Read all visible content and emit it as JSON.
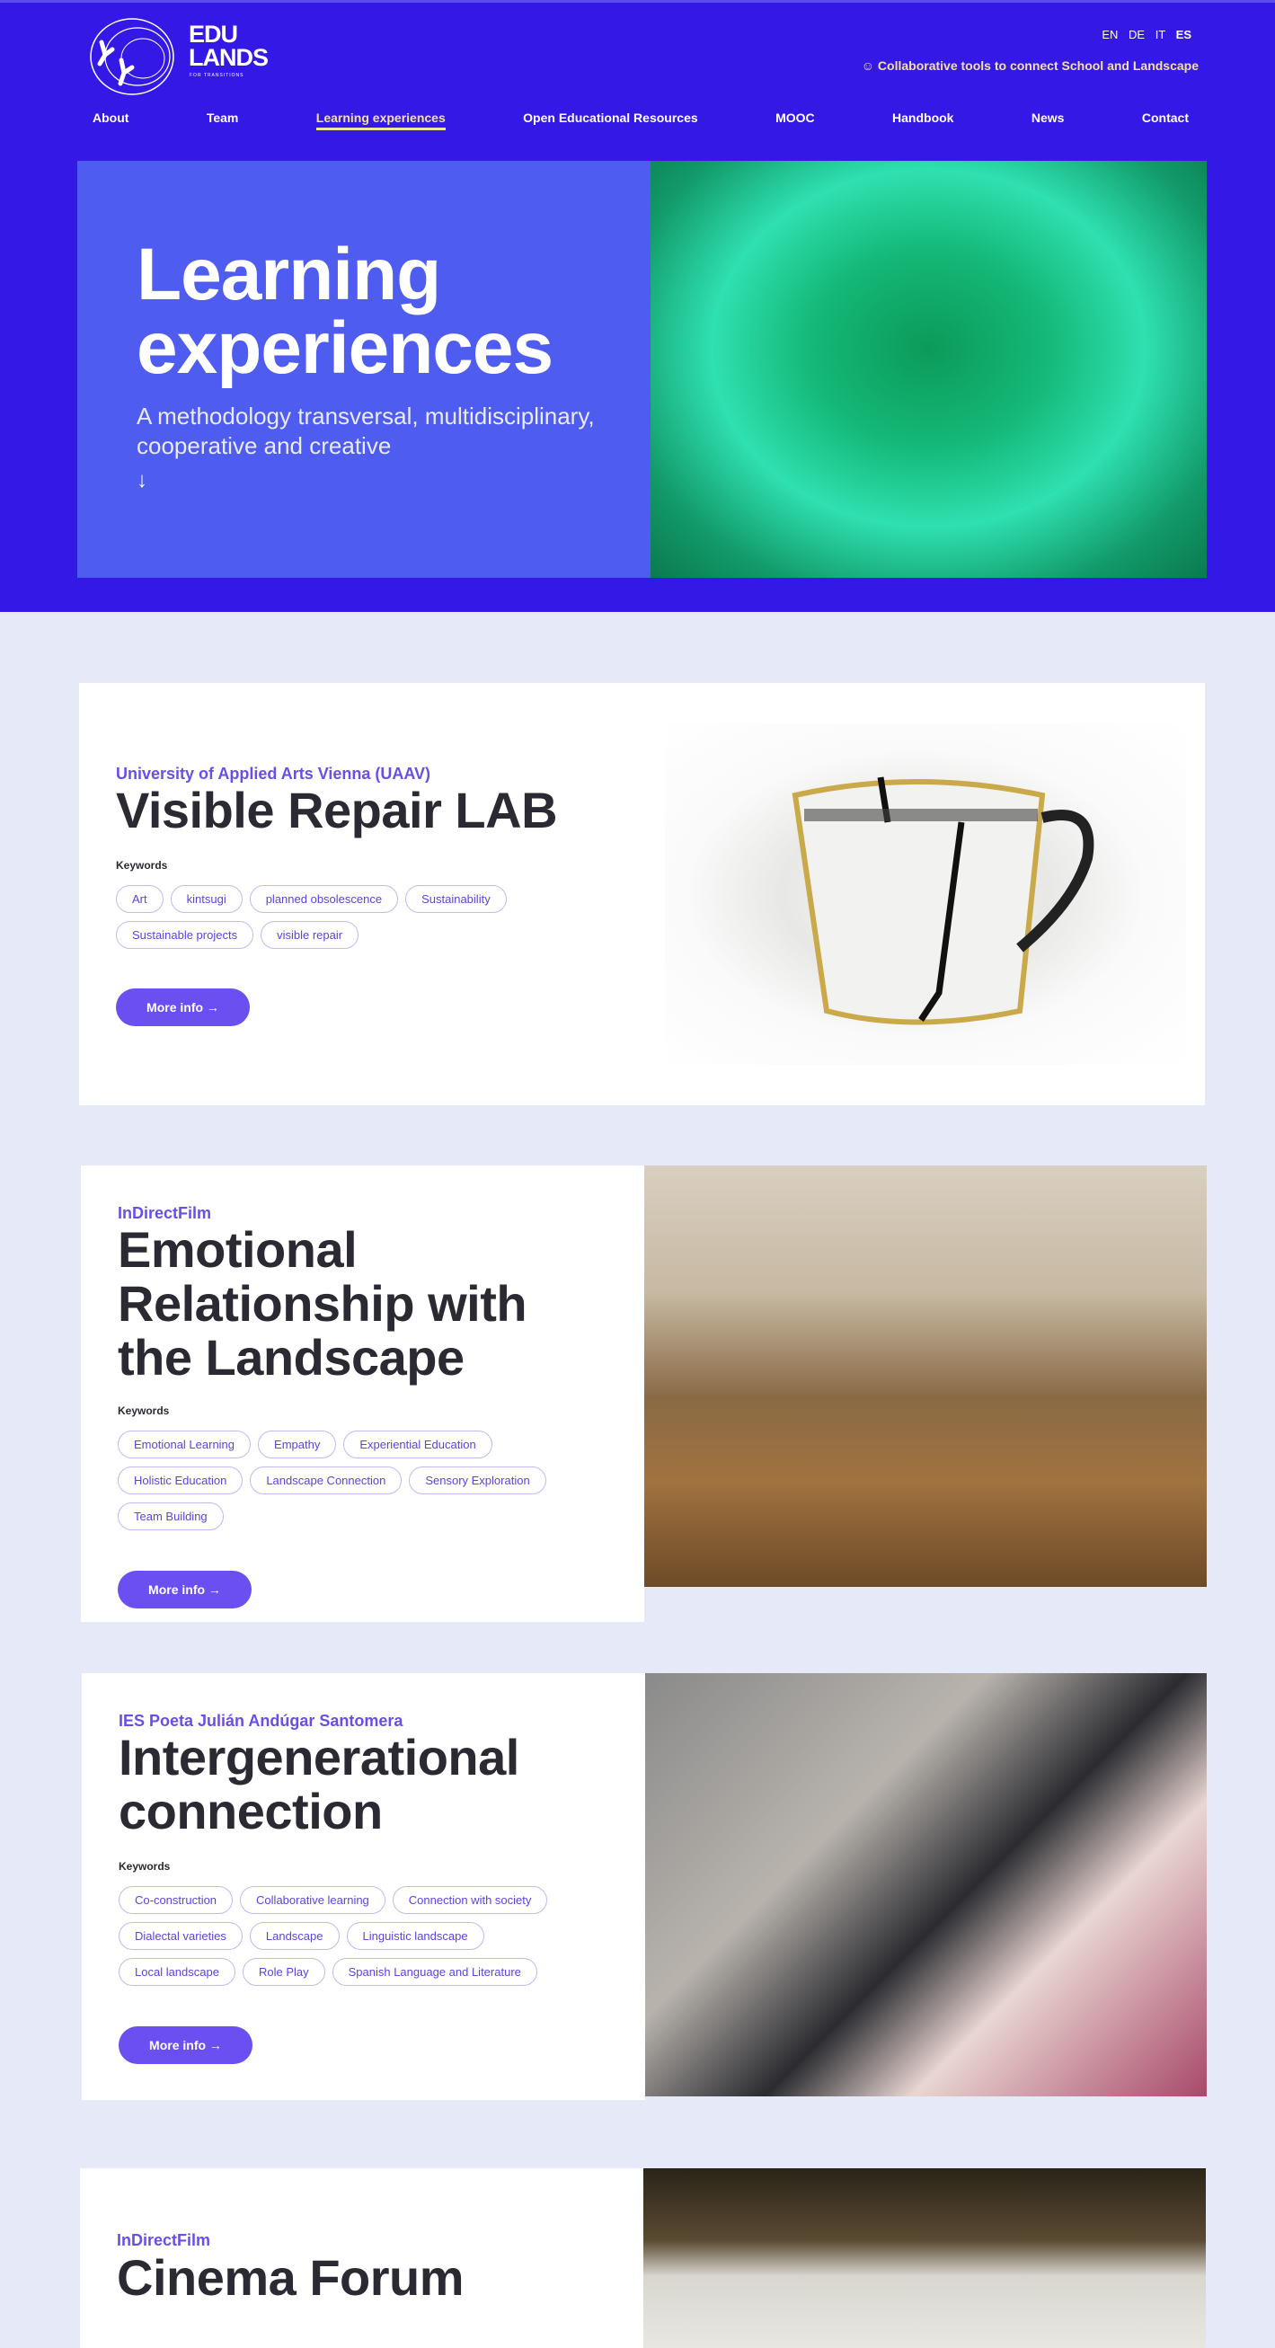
{
  "header": {
    "logo_text": "EDU LANDS",
    "logo_sub": "FOR TRANSITIONS",
    "languages": [
      "EN",
      "DE",
      "IT",
      "ES"
    ],
    "active_language": "ES",
    "tagline": "☺ Collaborative tools to connect School and Landscape",
    "nav": [
      "About",
      "Team",
      "Learning experiences",
      "Open Educational Resources",
      "MOOC",
      "Handbook",
      "News",
      "Contact"
    ],
    "active_nav": "Learning experiences"
  },
  "hero": {
    "title": "Learning experiences",
    "subtitle": "A methodology transversal, multidisciplinary, cooperative and creative",
    "arrow": "↓"
  },
  "keywords_label": "Keywords",
  "more_info_label": "More info →",
  "cards": [
    {
      "org": "University of Applied Arts Vienna (UAAV)",
      "title": "Visible Repair LAB",
      "tags": [
        "Art",
        "kintsugi",
        "planned obsolescence",
        "Sustainability",
        "Sustainable projects",
        "visible repair"
      ]
    },
    {
      "org": "InDirectFilm",
      "title": "Emotional Relationship with the Landscape",
      "tags": [
        "Emotional Learning",
        "Empathy",
        "Experiential Education",
        "Holistic Education",
        "Landscape Connection",
        "Sensory Exploration",
        "Team Building"
      ]
    },
    {
      "org": "IES Poeta Julián Andúgar Santomera",
      "title": "Intergenerational connection",
      "tags": [
        "Co-construction",
        "Collaborative learning",
        "Connection with society",
        "Dialectal varieties",
        "Landscape",
        "Linguistic landscape",
        "Local landscape",
        "Role Play",
        "Spanish Language and Literature"
      ]
    },
    {
      "org": "InDirectFilm",
      "title": "Cinema Forum"
    }
  ],
  "colors": {
    "header_bg": "#3418e6",
    "accent": "#6b4ff0",
    "nav_active": "#f3e39a",
    "page_bg": "#e6e9f7"
  }
}
